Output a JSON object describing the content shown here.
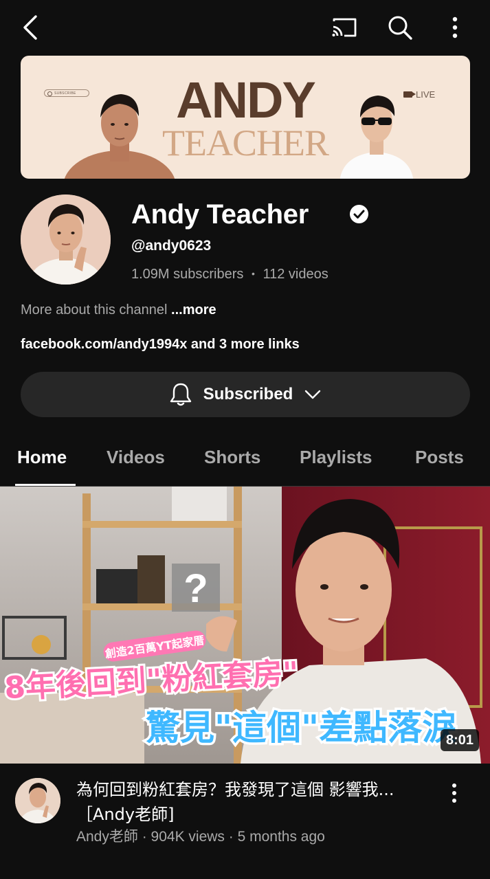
{
  "header": {
    "icons": [
      "back-arrow-icon",
      "cast-icon",
      "search-icon",
      "more-vertical-icon"
    ]
  },
  "banner": {
    "title": "ANDY",
    "subtitle": "TEACHER",
    "subscribe_label": "SUBSCRIBE",
    "live_label": "LIVE",
    "colors": {
      "background": "#f6e6d8",
      "title": "#5a3d2c",
      "subtitle": "#d2a785"
    }
  },
  "channel": {
    "name": "Andy Teacher",
    "handle": "@andy0623",
    "subscribers": "1.09M subscribers",
    "separator": "•",
    "videos": "112 videos",
    "about": "More about this channel",
    "about_more": "...more",
    "links": "facebook.com/andy1994x and 3 more links"
  },
  "subscribe": {
    "label": "Subscribed"
  },
  "tabs": [
    {
      "label": "Home",
      "active": true
    },
    {
      "label": "Videos",
      "active": false
    },
    {
      "label": "Shorts",
      "active": false
    },
    {
      "label": "Playlists",
      "active": false
    },
    {
      "label": "Posts",
      "active": false
    }
  ],
  "video": {
    "duration": "8:01",
    "overlay_caption_small": "創造2百萬YT起家厝",
    "overlay_caption_1": "8年後回到\"粉紅套房\"",
    "overlay_caption_2": "驚見\"這個\"差點落淚",
    "title": "為何回到粉紅套房？我發現了這個 影響我...［Andy老師]",
    "meta": "Andy老師 · 904K views · 5 months ago"
  }
}
